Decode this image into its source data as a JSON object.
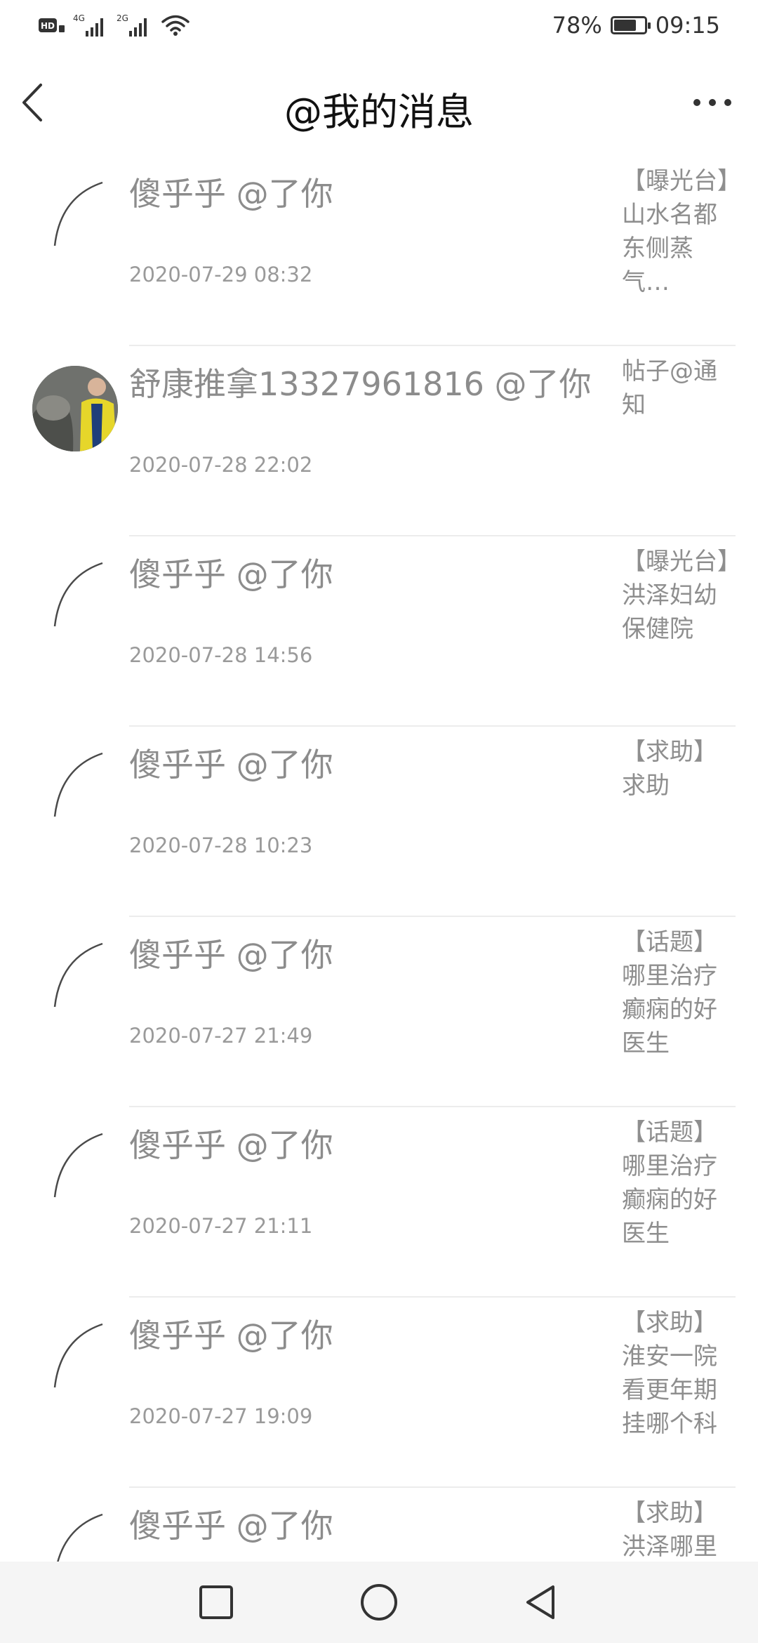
{
  "status_bar": {
    "network_hd": "HD",
    "network_4g": "4G",
    "network_2g": "2G",
    "battery_percent": "78%",
    "battery_level": 0.78,
    "time": "09:15"
  },
  "header": {
    "title": "@我的消息",
    "back_icon": "chevron-left-icon",
    "more_icon": "more-dots-icon"
  },
  "messages": [
    {
      "name": "傻乎乎 @了你",
      "time": "2020-07-29 08:32",
      "excerpt": "【曝光台】山水名都东侧蒸气…",
      "avatar": "placeholder"
    },
    {
      "name": "舒康推拿13327961816 @了你",
      "time": "2020-07-28 22:02",
      "excerpt": "帖子@通知",
      "avatar": "photo"
    },
    {
      "name": "傻乎乎 @了你",
      "time": "2020-07-28 14:56",
      "excerpt": "【曝光台】洪泽妇幼保健院",
      "avatar": "placeholder"
    },
    {
      "name": "傻乎乎 @了你",
      "time": "2020-07-28 10:23",
      "excerpt": "【求助】求助",
      "avatar": "placeholder"
    },
    {
      "name": "傻乎乎 @了你",
      "time": "2020-07-27 21:49",
      "excerpt": "【话题】哪里治疗癫痫的好医生",
      "avatar": "placeholder"
    },
    {
      "name": "傻乎乎 @了你",
      "time": "2020-07-27 21:11",
      "excerpt": "【话题】哪里治疗癫痫的好医生",
      "avatar": "placeholder"
    },
    {
      "name": "傻乎乎 @了你",
      "time": "2020-07-27 19:09",
      "excerpt": "【求助】淮安一院看更年期挂哪个科",
      "avatar": "placeholder"
    },
    {
      "name": "傻乎乎 @了你",
      "time": "",
      "excerpt": "【求助】洪泽哪里",
      "avatar": "placeholder"
    }
  ],
  "nav_bar": {
    "recent_icon": "square-icon",
    "home_icon": "circle-icon",
    "back_icon": "triangle-back-icon"
  }
}
